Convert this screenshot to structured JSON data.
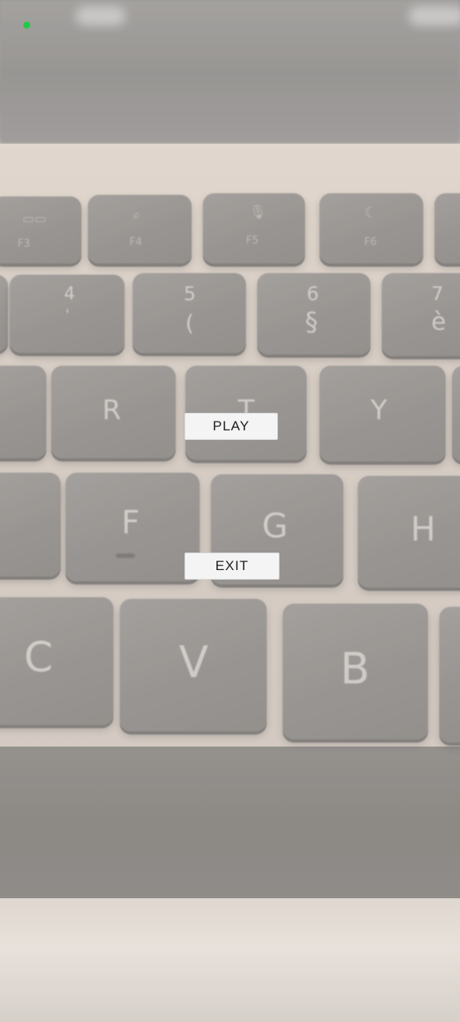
{
  "menu": {
    "play_label": "PLAY",
    "exit_label": "EXIT"
  },
  "background": {
    "description_icon": "keyboard-photo-background",
    "function_keys": [
      {
        "icon": "mission-control-icon",
        "label": "F3"
      },
      {
        "icon": "search-icon",
        "label": "F4"
      },
      {
        "icon": "microphone-icon",
        "label": "F5"
      },
      {
        "icon": "moon-icon",
        "label": "F6"
      }
    ],
    "number_keys": [
      {
        "top": "4",
        "bottom": "'"
      },
      {
        "top": "5",
        "bottom": "("
      },
      {
        "top": "6",
        "bottom": "§"
      },
      {
        "top": "7",
        "bottom": "è"
      }
    ],
    "letter_row_1": [
      "R",
      "T",
      "Y"
    ],
    "letter_row_2": [
      "F",
      "G",
      "H"
    ],
    "letter_row_3": [
      "C",
      "V",
      "B"
    ]
  },
  "status": {
    "indicator_color": "#25c94a"
  }
}
